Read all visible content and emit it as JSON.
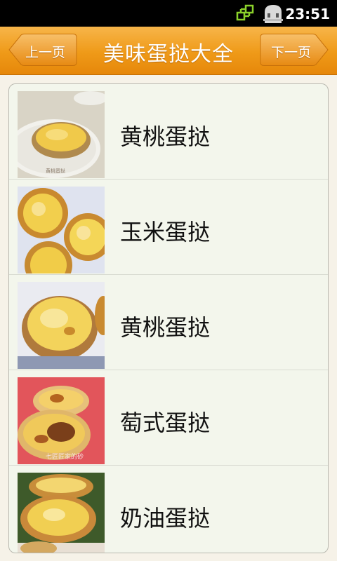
{
  "status_bar": {
    "time": "23:51",
    "icons": [
      "network-sync-icon",
      "usb-debug-icon"
    ]
  },
  "header": {
    "title": "美味蛋挞大全",
    "prev_label": "上一页",
    "next_label": "下一页",
    "accent_color": "#ef9a18"
  },
  "list": {
    "items": [
      {
        "label": "黄桃蛋挞",
        "thumb": "egg-tart-on-plate-photo"
      },
      {
        "label": "玉米蛋挞",
        "thumb": "egg-tarts-on-doily-photo"
      },
      {
        "label": "黄桃蛋挞",
        "thumb": "egg-tart-lace-doily-photo"
      },
      {
        "label": "萄式蛋挞",
        "thumb": "portuguese-tart-photo"
      },
      {
        "label": "奶油蛋挞",
        "thumb": "cream-tart-photo"
      }
    ]
  }
}
